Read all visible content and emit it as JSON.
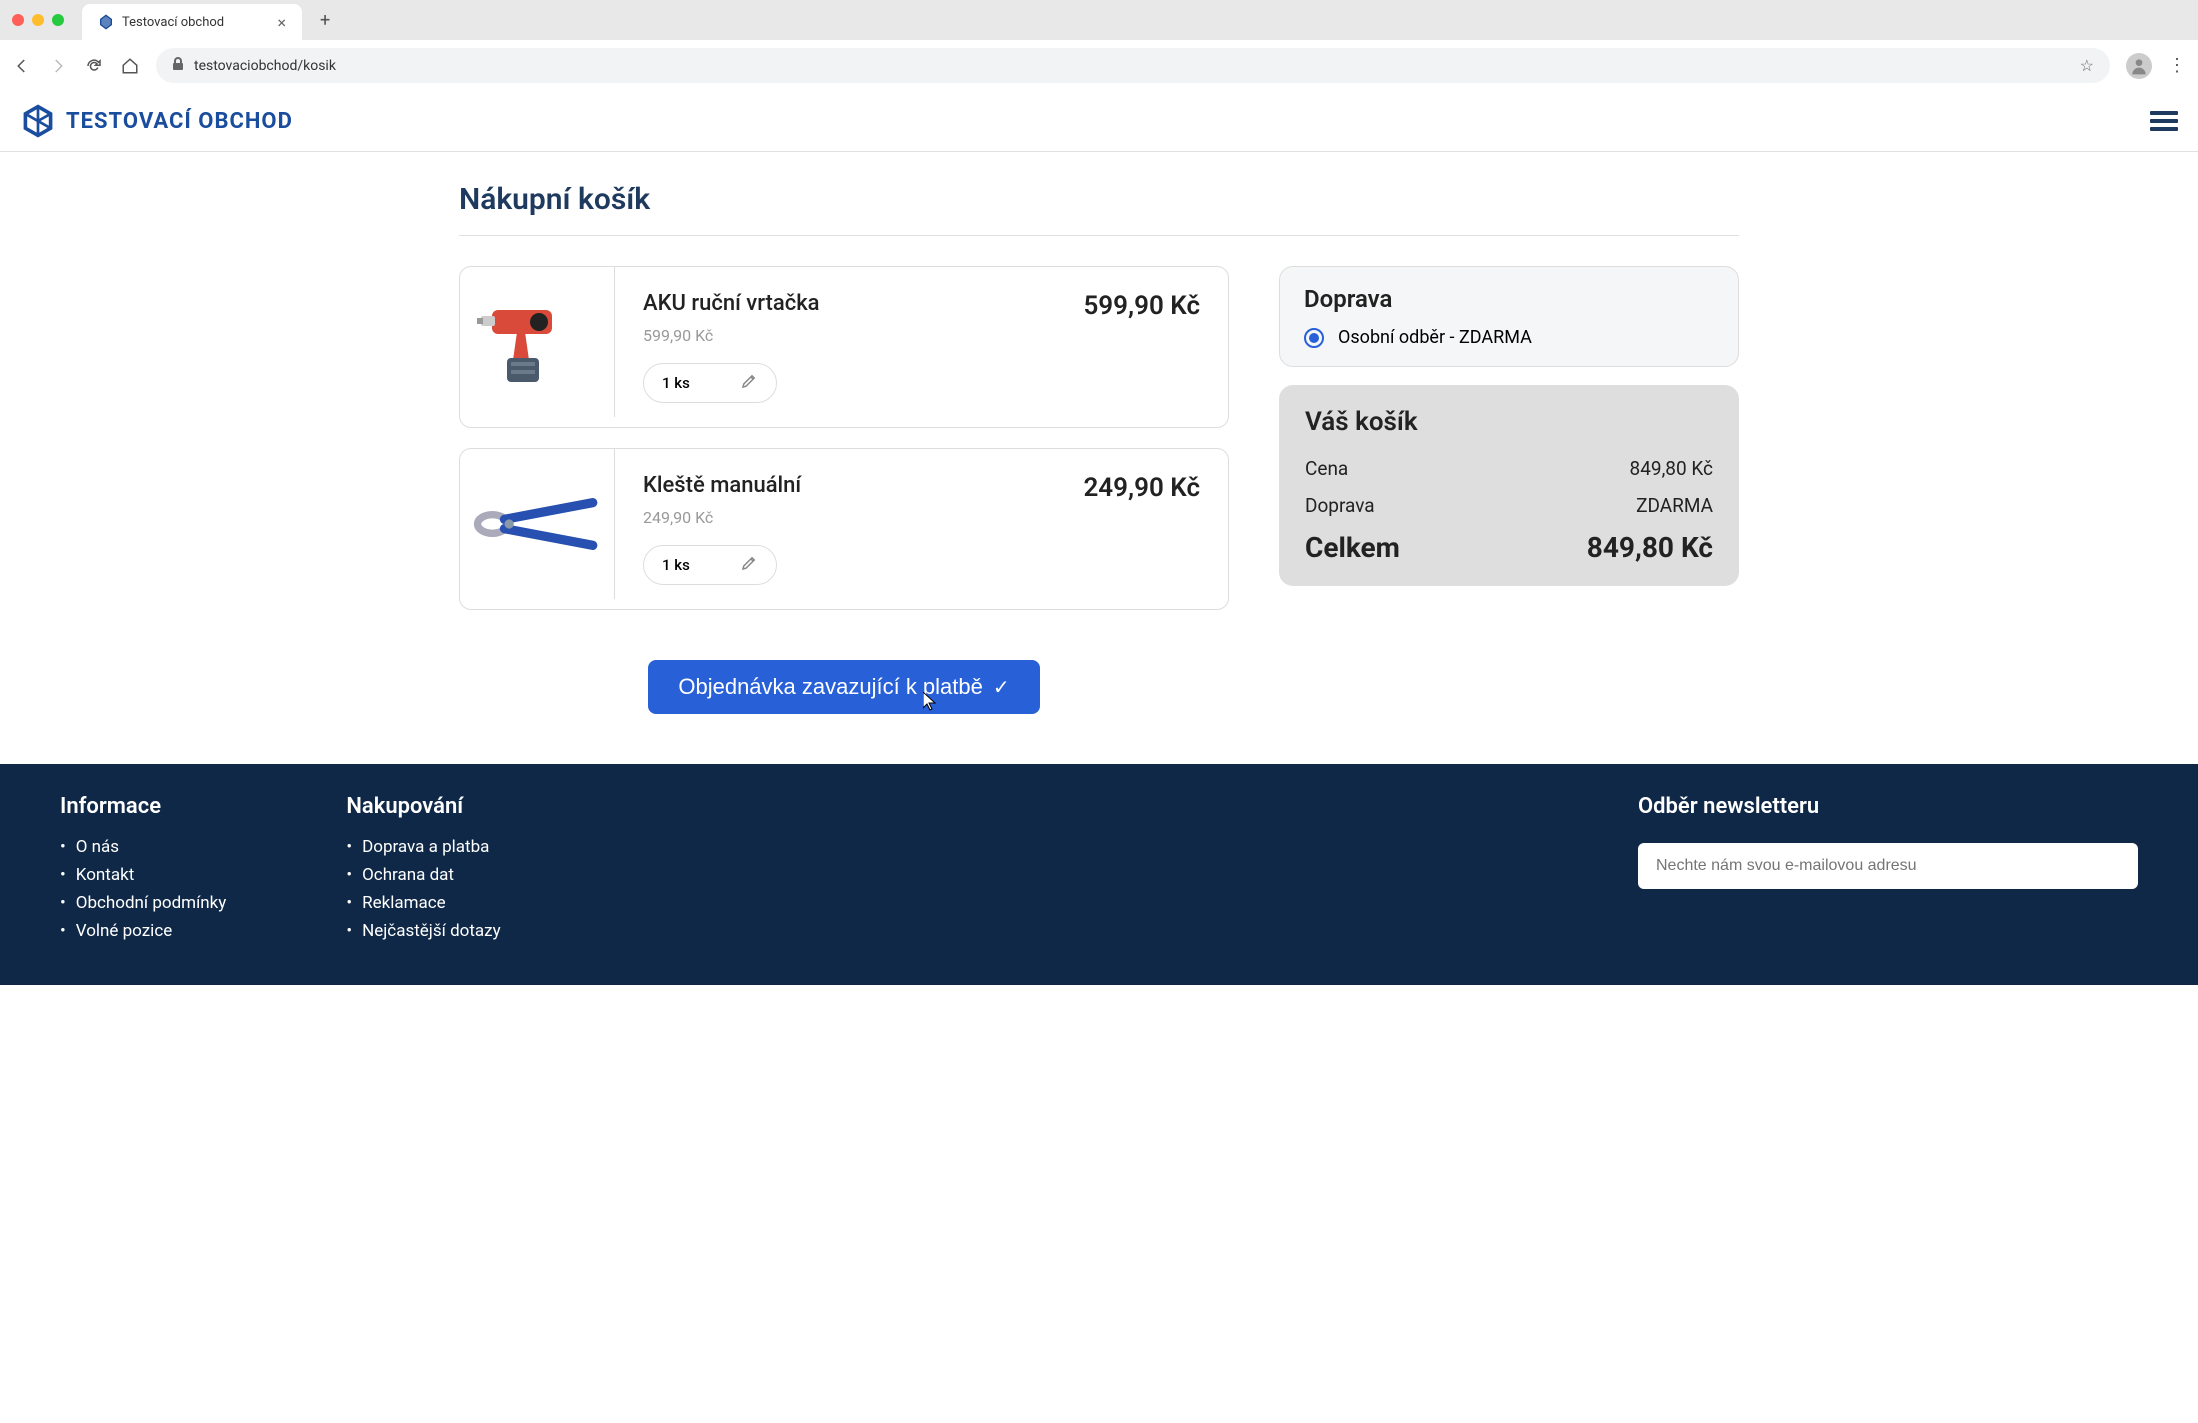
{
  "browser": {
    "tab_title": "Testovací obchod",
    "url": "testovaciobchod/kosik"
  },
  "header": {
    "logo_text": "TESTOVACÍ OBCHOD"
  },
  "page": {
    "title": "Nákupní košík"
  },
  "cart": {
    "items": [
      {
        "name": "AKU ruční vrtačka",
        "unit_price": "599,90 Kč",
        "quantity": "1 ks",
        "total": "599,90 Kč"
      },
      {
        "name": "Kleště manuální",
        "unit_price": "249,90 Kč",
        "quantity": "1 ks",
        "total": "249,90 Kč"
      }
    ]
  },
  "shipping": {
    "title": "Doprava",
    "option": "Osobní odběr - ZDARMA"
  },
  "summary": {
    "title": "Váš košík",
    "price_label": "Cena",
    "price_value": "849,80 Kč",
    "shipping_label": "Doprava",
    "shipping_value": "ZDARMA",
    "total_label": "Celkem",
    "total_value": "849,80 Kč"
  },
  "order_button": "Objednávka zavazující k platbě",
  "footer": {
    "info": {
      "title": "Informace",
      "links": [
        "O nás",
        "Kontakt",
        "Obchodní podmínky",
        "Volné pozice"
      ]
    },
    "shopping": {
      "title": "Nakupování",
      "links": [
        "Doprava a platba",
        "Ochrana dat",
        "Reklamace",
        "Nejčastější dotazy"
      ]
    },
    "newsletter": {
      "title": "Odběr newsletteru",
      "placeholder": "Nechte nám svou e-mailovou adresu"
    }
  }
}
